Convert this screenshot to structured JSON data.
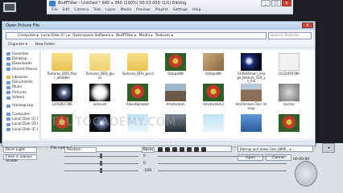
{
  "app": {
    "title": "BluffTitler - Untitled * 640 x 360 (100%) 00:03.000 (1/1) Editing",
    "menus": [
      "File",
      "Edit",
      "Camera",
      "Text",
      "Layer",
      "Media",
      "Preview",
      "Playlist",
      "Settings",
      "Help"
    ],
    "left_label": "Computer"
  },
  "dialog": {
    "title": "Open Picture File",
    "close_label": "X",
    "breadcrumb": [
      "Computer",
      "Local Disk (C:)",
      "Outerspace Software",
      "BluffTitler",
      "Media",
      "Textures"
    ],
    "search_placeholder": "Search Textures",
    "toolbar": [
      "Organize ▾",
      "New folder"
    ],
    "nav": [
      {
        "label": "Favorites",
        "icon": "star-icon",
        "y": false
      },
      {
        "label": "Desktop",
        "icon": "desktop-icon",
        "y": false
      },
      {
        "label": "Downloads",
        "icon": "download-icon",
        "y": false
      },
      {
        "label": "Recent Places",
        "icon": "recent-icon",
        "y": false
      },
      {
        "label": "",
        "icon": "spacer",
        "y": false
      },
      {
        "label": "Libraries",
        "icon": "library-icon",
        "y": true
      },
      {
        "label": "Documents",
        "icon": "documents-icon",
        "y": false
      },
      {
        "label": "Music",
        "icon": "music-icon",
        "y": false
      },
      {
        "label": "Pictures",
        "icon": "pictures-icon",
        "y": false
      },
      {
        "label": "Videos",
        "icon": "videos-icon",
        "y": false
      },
      {
        "label": "",
        "icon": "spacer",
        "y": false
      },
      {
        "label": "Homegroup",
        "icon": "homegroup-icon",
        "y": false
      },
      {
        "label": "",
        "icon": "spacer",
        "y": false
      },
      {
        "label": "Computer",
        "icon": "computer-icon",
        "y": false
      },
      {
        "label": "Local Disk (C:)",
        "icon": "disk-icon",
        "y": false
      },
      {
        "label": "Local Disk (D:)",
        "icon": "disk-icon",
        "y": false
      },
      {
        "label": "Local Disk (E:)",
        "icon": "disk-icon",
        "y": false
      }
    ],
    "files": [
      {
        "name": "Textures_DDS_floo r_wmbble",
        "thumb": "fold"
      },
      {
        "name": "Textures_DDS_gla ss",
        "thumb": "fold2"
      },
      {
        "name": "Textures_DDS_gol d",
        "thumb": "fold"
      },
      {
        "name": "0steps8W",
        "thumb": "img-red"
      },
      {
        "name": "0steps8W",
        "thumb": "img-wood"
      },
      {
        "name": "143836main_ima ge_feature_519_y s_full",
        "thumb": "img-gal"
      },
      {
        "name": "0123456789",
        "thumb": "img-blank"
      },
      {
        "name": "1205855789",
        "thumb": "img-space"
      },
      {
        "name": "airbrush",
        "thumb": "img-light"
      },
      {
        "name": "AlienAlphabet",
        "thumb": "img-red"
      },
      {
        "name": "Amsterdam",
        "thumb": "img-city"
      },
      {
        "name": "Amsterdam2",
        "thumb": "img-red"
      },
      {
        "name": "Amsterdam-Tour ist map",
        "thumb": "img-town"
      },
      {
        "name": "Anchor",
        "thumb": "img-anchor"
      },
      {
        "name": "",
        "thumb": "img-red"
      },
      {
        "name": "",
        "thumb": "img-space"
      },
      {
        "name": "",
        "thumb": "img-ice"
      },
      {
        "name": "",
        "thumb": "img-alien"
      },
      {
        "name": "",
        "thumb": "img-ice"
      },
      {
        "name": "",
        "thumb": "img-tex"
      },
      {
        "name": "",
        "thumb": "img-red"
      }
    ],
    "file_name_label": "File name:",
    "file_type": "Bitmap and Video Files (BMP... ▾",
    "open_label": "Open",
    "cancel_label": "Cancel"
  },
  "properties": {
    "light": "Point Light",
    "visibility": "Flare is always Visible",
    "position": "Position",
    "reset_label": "Reset",
    "values": [
      "0",
      "0",
      "-200"
    ],
    "time_primary": "00:00:00",
    "time_secondary": "00:00.000"
  },
  "watermark": "TAUTOCADEMY.COM",
  "colors": {
    "accent": "#3a7fd0",
    "dialog_bg": "#eef2f8",
    "close": "#c9473d"
  }
}
